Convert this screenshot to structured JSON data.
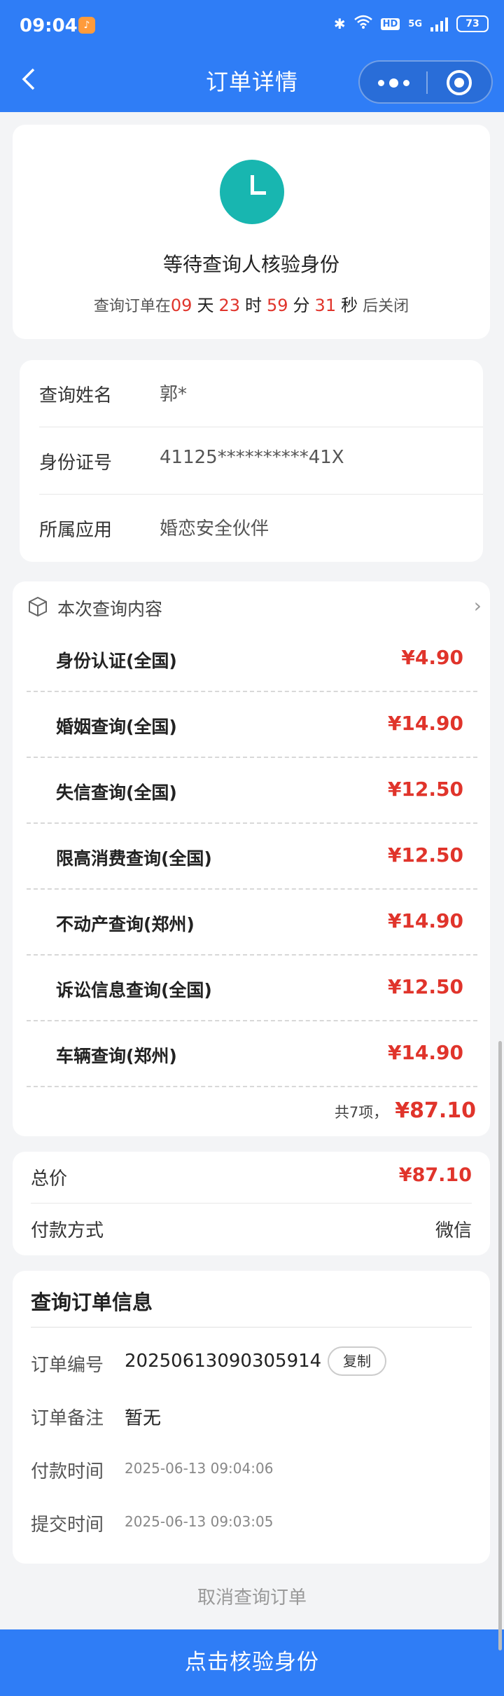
{
  "status_bar": {
    "time": "09:04",
    "app_icon": "app-notification-icon",
    "hd": "HD",
    "network": "5G",
    "battery": "73"
  },
  "nav": {
    "title": "订单详情",
    "back_icon": "back-arrow-icon",
    "more_icon": "more-dots-icon",
    "close_icon": "target-circle-icon"
  },
  "status": {
    "icon": "clock-icon",
    "title": "等待查询人核验身份",
    "countdown": {
      "prefix": "查询订单在",
      "days": "09",
      "days_unit": "天",
      "hours": "23",
      "hours_unit": "时",
      "minutes": "59",
      "minutes_unit": "分",
      "seconds": "31",
      "seconds_unit": "秒",
      "suffix": "后关闭"
    }
  },
  "info": [
    {
      "label": "查询姓名",
      "value": "郭*"
    },
    {
      "label": "身份证号",
      "value": "41125**********41X"
    },
    {
      "label": "所属应用",
      "value": "婚恋安全伙伴"
    }
  ],
  "items": {
    "title": "本次查询内容",
    "rows": [
      {
        "name": "身份认证(全国)",
        "price": "¥4.90"
      },
      {
        "name": "婚姻查询(全国)",
        "price": "¥14.90"
      },
      {
        "name": "失信查询(全国)",
        "price": "¥12.50"
      },
      {
        "name": "限高消费查询(全国)",
        "price": "¥12.50"
      },
      {
        "name": "不动产查询(郑州)",
        "price": "¥14.90"
      },
      {
        "name": "诉讼信息查询(全国)",
        "price": "¥12.50"
      },
      {
        "name": "车辆查询(郑州)",
        "price": "¥14.90"
      }
    ],
    "total_label": "共7项，",
    "total_amount": "¥87.10"
  },
  "payment": {
    "total_label": "总价",
    "total_value": "¥87.10",
    "method_label": "付款方式",
    "method_value": "微信"
  },
  "order": {
    "title": "查询订单信息",
    "number_label": "订单编号",
    "number_value": "20250613090305914",
    "copy_label": "复制",
    "remark_label": "订单备注",
    "remark_value": "暂无",
    "paid_label": "付款时间",
    "paid_value": "2025-06-13 09:04:06",
    "submit_label": "提交时间",
    "submit_value": "2025-06-13 09:03:05"
  },
  "actions": {
    "cancel_label": "取消查询订单",
    "verify_label": "点击核验身份"
  }
}
